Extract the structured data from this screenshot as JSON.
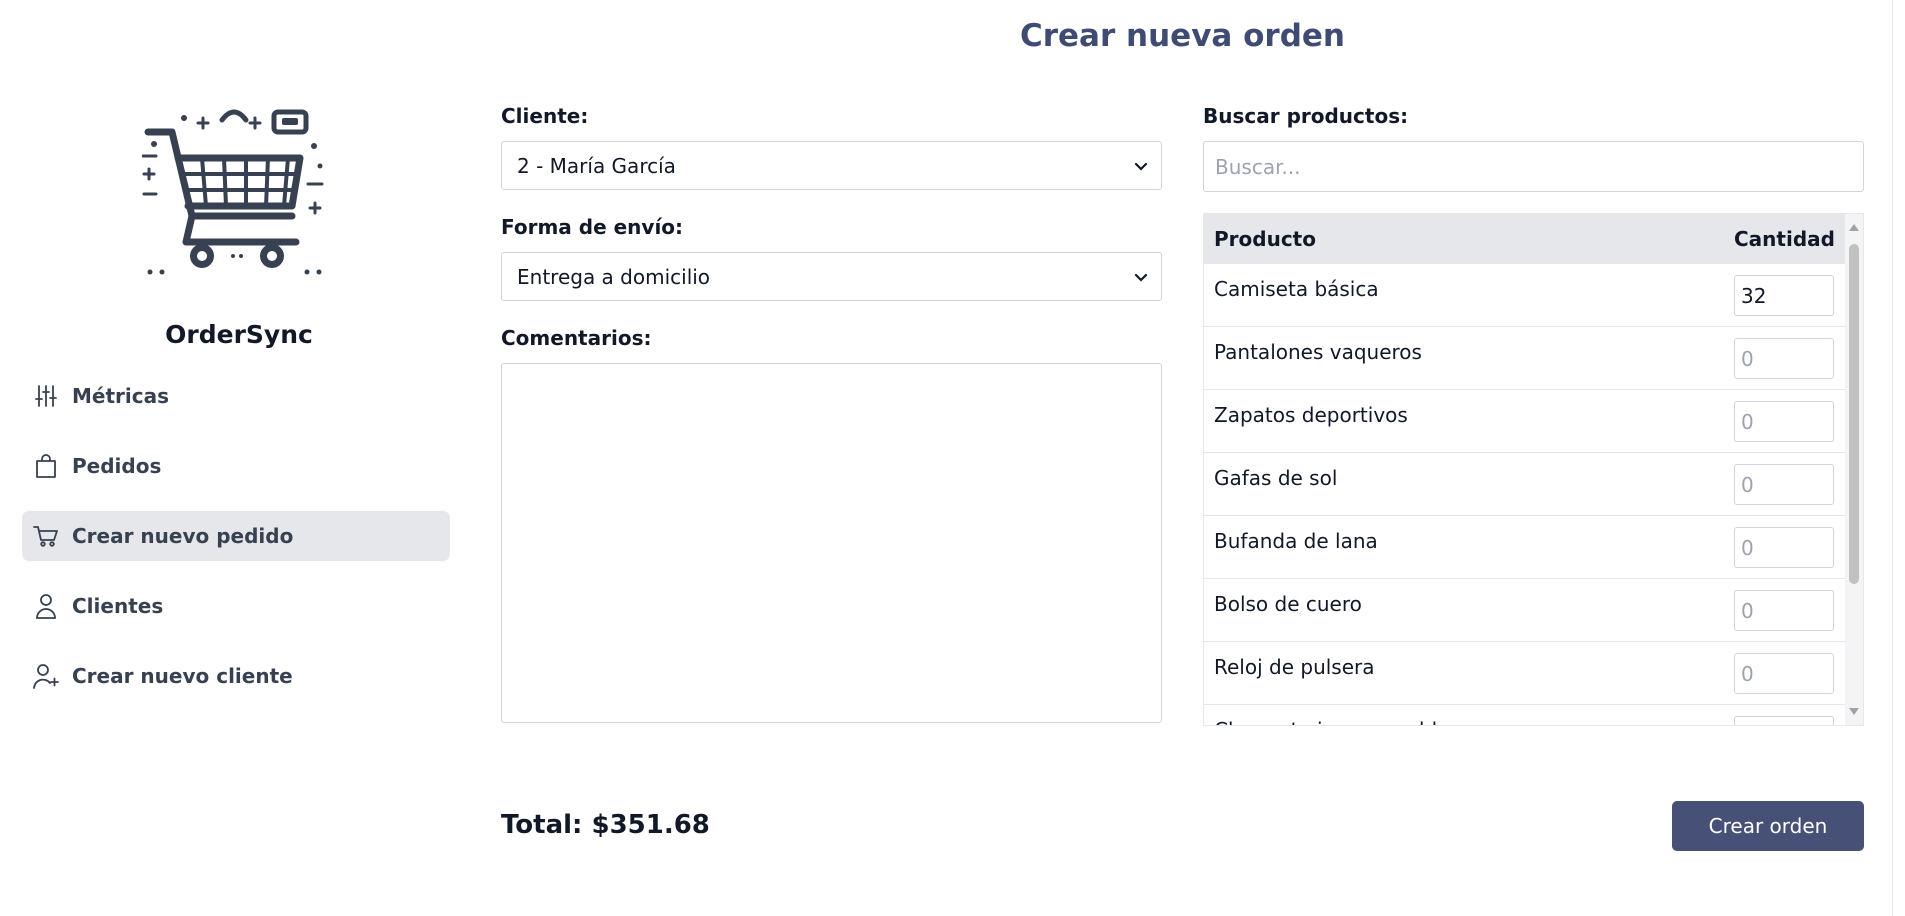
{
  "app": {
    "brand": "OrderSync"
  },
  "sidebar": {
    "items": [
      {
        "label": "Métricas",
        "icon": "sliders-icon"
      },
      {
        "label": "Pedidos",
        "icon": "shopping-bag-icon"
      },
      {
        "label": "Crear nuevo pedido",
        "icon": "cart-icon",
        "active": true
      },
      {
        "label": "Clientes",
        "icon": "user-icon"
      },
      {
        "label": "Crear nuevo cliente",
        "icon": "user-plus-icon"
      }
    ]
  },
  "page": {
    "title": "Crear nueva orden"
  },
  "form": {
    "client_label": "Cliente:",
    "client_value": "2 - María García",
    "shipping_label": "Forma de envío:",
    "shipping_value": "Entrega a domicilio",
    "comments_label": "Comentarios:",
    "comments_value": ""
  },
  "products": {
    "search_label": "Buscar productos:",
    "search_placeholder": "Buscar...",
    "headers": {
      "product": "Producto",
      "quantity": "Cantidad"
    },
    "qty_placeholder": "0",
    "rows": [
      {
        "name": "Camiseta básica",
        "qty": "32"
      },
      {
        "name": "Pantalones vaqueros",
        "qty": ""
      },
      {
        "name": "Zapatos deportivos",
        "qty": ""
      },
      {
        "name": "Gafas de sol",
        "qty": ""
      },
      {
        "name": "Bufanda de lana",
        "qty": ""
      },
      {
        "name": "Bolso de cuero",
        "qty": ""
      },
      {
        "name": "Reloj de pulsera",
        "qty": ""
      },
      {
        "name": "Chaqueta impermeable",
        "qty": ""
      }
    ]
  },
  "footer": {
    "total": "Total: $351.68",
    "create_button": "Crear orden"
  },
  "colors": {
    "accent": "#475077",
    "title": "#3f4b73",
    "active_nav": "#e5e7eb"
  }
}
